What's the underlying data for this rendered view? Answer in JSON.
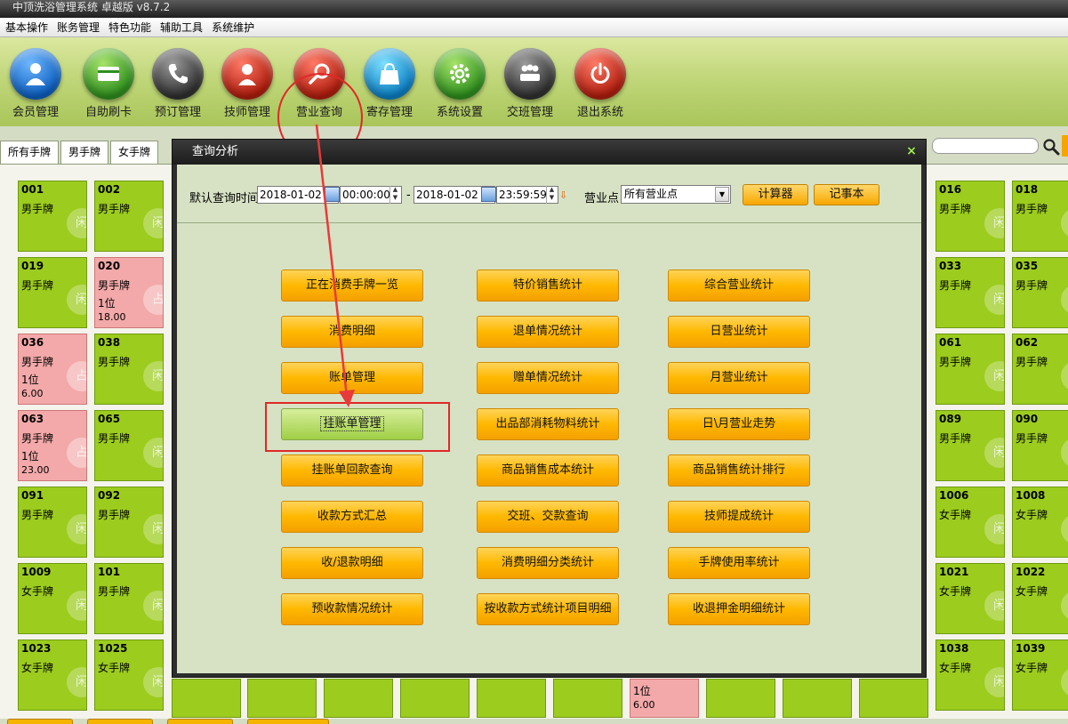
{
  "window": {
    "title": "中顶洗浴管理系统 卓越版 v8.7.2"
  },
  "menu": [
    "基本操作",
    "账务管理",
    "特色功能",
    "辅助工具",
    "系统维护"
  ],
  "toolbar": [
    {
      "label": "会员管理",
      "icon": "member-icon",
      "color": "blue"
    },
    {
      "label": "自助刷卡",
      "icon": "card-icon",
      "color": "green"
    },
    {
      "label": "预订管理",
      "icon": "phone-icon",
      "color": "gray"
    },
    {
      "label": "技师管理",
      "icon": "technician-icon",
      "color": "red"
    },
    {
      "label": "营业查询",
      "icon": "search-icon",
      "color": "red"
    },
    {
      "label": "寄存管理",
      "icon": "bag-icon",
      "color": "cyan"
    },
    {
      "label": "系统设置",
      "icon": "gear-icon",
      "color": "green"
    },
    {
      "label": "交班管理",
      "icon": "meeting-icon",
      "color": "gray"
    },
    {
      "label": "退出系统",
      "icon": "power-icon",
      "color": "red"
    }
  ],
  "tabs": [
    "所有手牌",
    "男手牌",
    "女手牌"
  ],
  "cards_left": [
    [
      {
        "num": "001",
        "type": "男手牌"
      },
      {
        "num": "002",
        "type": "男手牌"
      }
    ],
    [
      {
        "num": "019",
        "type": "男手牌"
      },
      {
        "num": "020",
        "type": "男手牌",
        "ppl": "1位",
        "amt": "18.00",
        "busy": true
      }
    ],
    [
      {
        "num": "036",
        "type": "男手牌",
        "ppl": "1位",
        "amt": "6.00",
        "busy": true
      },
      {
        "num": "038",
        "type": "男手牌"
      }
    ],
    [
      {
        "num": "063",
        "type": "男手牌",
        "ppl": "1位",
        "amt": "23.00",
        "busy": true
      },
      {
        "num": "065",
        "type": "男手牌"
      }
    ],
    [
      {
        "num": "091",
        "type": "男手牌"
      },
      {
        "num": "092",
        "type": "男手牌"
      }
    ],
    [
      {
        "num": "1009",
        "type": "女手牌"
      },
      {
        "num": "101",
        "type": "男手牌"
      }
    ],
    [
      {
        "num": "1023",
        "type": "女手牌"
      },
      {
        "num": "1025",
        "type": "女手牌"
      }
    ]
  ],
  "cards_right": [
    [
      {
        "num": "016",
        "type": "男手牌"
      },
      {
        "num": "018",
        "type": "男手牌"
      }
    ],
    [
      {
        "num": "033",
        "type": "男手牌"
      },
      {
        "num": "035",
        "type": "男手牌"
      }
    ],
    [
      {
        "num": "061",
        "type": "男手牌"
      },
      {
        "num": "062",
        "type": "男手牌"
      }
    ],
    [
      {
        "num": "089",
        "type": "男手牌"
      },
      {
        "num": "090",
        "type": "男手牌"
      }
    ],
    [
      {
        "num": "1006",
        "type": "女手牌"
      },
      {
        "num": "1008",
        "type": "女手牌"
      }
    ],
    [
      {
        "num": "1021",
        "type": "女手牌"
      },
      {
        "num": "1022",
        "type": "女手牌"
      }
    ],
    [
      {
        "num": "1038",
        "type": "女手牌"
      },
      {
        "num": "1039",
        "type": "女手牌"
      }
    ]
  ],
  "hidden_card": {
    "ppl": "1位",
    "amt": "6.00"
  },
  "watermark": {
    "free": "闲",
    "busy": "占"
  },
  "dialog": {
    "title": "查询分析",
    "close": "×",
    "query_label": "默认查询时间",
    "start_date": "2018-01-02",
    "start_time": "00:00:00",
    "dash": "-",
    "end_date": "2018-01-02",
    "end_time": "23:59:59",
    "point_label": "营业点",
    "point_value": "所有营业点",
    "calc_btn": "计算器",
    "note_btn": "记事本",
    "functions": [
      [
        "正在消费手牌一览",
        "特价销售统计",
        "综合营业统计"
      ],
      [
        "消费明细",
        "退单情况统计",
        "日营业统计"
      ],
      [
        "账单管理",
        "赠单情况统计",
        "月营业统计"
      ],
      [
        "挂账单管理",
        "出品部消耗物料统计",
        "日\\月营业走势"
      ],
      [
        "挂账单回款查询",
        "商品销售成本统计",
        "商品销售统计排行"
      ],
      [
        "收款方式汇总",
        "交班、交款查询",
        "技师提成统计"
      ],
      [
        "收/退款明细",
        "消费明细分类统计",
        "手牌使用率统计"
      ],
      [
        "预收款情况统计",
        "按收款方式统计项目明细",
        "收退押金明细统计"
      ]
    ],
    "selected": "挂账单管理"
  },
  "colors": {
    "card_free": "#9ccc1e",
    "card_busy": "#f3a9a9",
    "accent_orange": "#ffb800",
    "annotation_red": "#e02828"
  }
}
